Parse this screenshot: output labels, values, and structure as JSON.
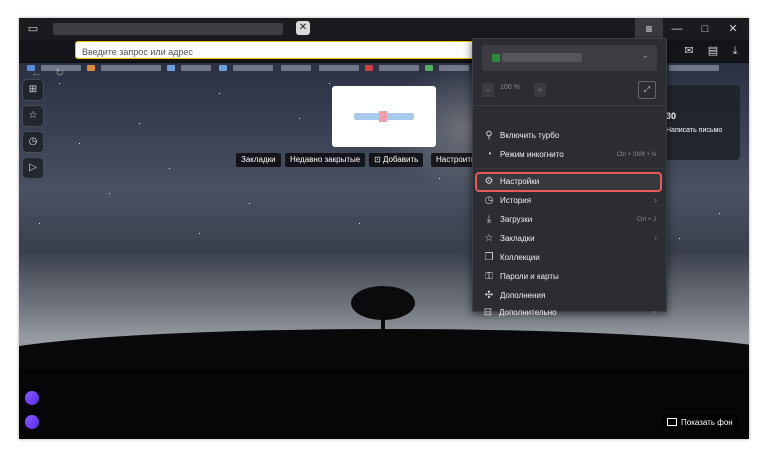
{
  "address_bar": {
    "placeholder": "Введите запрос или адрес"
  },
  "tile_chips": [
    "Закладки",
    "Недавно закрытые",
    "Добавить",
    "Настроить"
  ],
  "widget": {
    "count": "30",
    "text": "Написать письмо"
  },
  "menu": {
    "zoom": "100 %",
    "items": [
      {
        "icon": "rocket-icon",
        "glyph": "⚲",
        "label": "Включить турбо",
        "shortcut": "",
        "arrow": false
      },
      {
        "icon": "incognito-icon",
        "glyph": "◔",
        "label": "Режим инкогнито",
        "shortcut": "Ctrl + Shift + N",
        "arrow": false
      },
      {
        "icon": "gear-icon",
        "glyph": "⚙",
        "label": "Настройки",
        "shortcut": "",
        "arrow": false
      },
      {
        "icon": "history-icon",
        "glyph": "◷",
        "label": "История",
        "shortcut": "",
        "arrow": true
      },
      {
        "icon": "download-icon",
        "glyph": "⤓",
        "label": "Загрузки",
        "shortcut": "Ctrl + J",
        "arrow": false
      },
      {
        "icon": "star-icon",
        "glyph": "☆",
        "label": "Закладки",
        "shortcut": "",
        "arrow": true
      },
      {
        "icon": "collections-icon",
        "glyph": "❐",
        "label": "Коллекции",
        "shortcut": "",
        "arrow": false
      },
      {
        "icon": "key-icon",
        "glyph": "⚿",
        "label": "Пароли и карты",
        "shortcut": "",
        "arrow": false
      },
      {
        "icon": "puzzle-icon",
        "glyph": "✣",
        "label": "Дополнения",
        "shortcut": "",
        "arrow": false
      },
      {
        "icon": "more-icon",
        "glyph": "⊟",
        "label": "Дополнительно",
        "shortcut": "",
        "arrow": true
      }
    ]
  },
  "show_background": "Показать фон",
  "accent": "#f2c200",
  "highlight": "#e55b5b"
}
